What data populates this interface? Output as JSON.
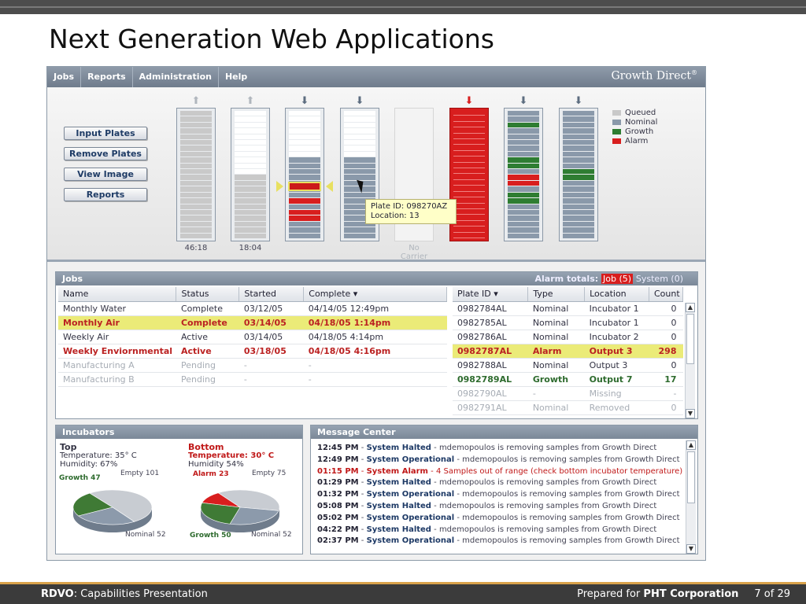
{
  "slide": {
    "title": "Next Generation Web Applications",
    "footer_left_bold": "RDVO",
    "footer_left_rest": ": Capabilities Presentation",
    "footer_prepared": "Prepared for ",
    "footer_client": "PHT Corporation",
    "footer_page": "7 of 29"
  },
  "app": {
    "menu": [
      "Jobs",
      "Reports",
      "Administration",
      "Help"
    ],
    "brand": "Growth Direct",
    "brand_mark": "®"
  },
  "actions": {
    "input_plates": "Input Plates",
    "remove_plates": "Remove Plates",
    "view_image": "View Image",
    "reports": "Reports"
  },
  "carriers": [
    {
      "arrow": "up",
      "label": "46:18",
      "pattern": "qqqqqqqqqqqqqqqqqqqqqq"
    },
    {
      "arrow": "up",
      "label": "18:04",
      "pattern": "eeeeeeeeeeeqqqqqqqqqqq"
    },
    {
      "arrow": "down",
      "label": "",
      "pattern": "eeeeeeeennnnnnnanaannn"
    },
    {
      "arrow": "down",
      "label": "",
      "pattern": "eeeeeeeennnnnnnnnnnnnn"
    },
    {
      "arrow": "none",
      "label": "No Carrier",
      "pattern": "empty"
    },
    {
      "arrow": "down-red",
      "label": "",
      "pattern": "alarm"
    },
    {
      "arrow": "down",
      "label": "",
      "pattern": "nngnnnnnggnaanggnnnnnn"
    },
    {
      "arrow": "down",
      "label": "",
      "pattern": "nnnnnnnnnnggnnnnnnnnnn"
    }
  ],
  "tooltip": {
    "line1": "Plate ID: 098270AZ",
    "line2": "Location: 13"
  },
  "legend": [
    {
      "label": "Queued",
      "color": "#c9c9c9"
    },
    {
      "label": "Nominal",
      "color": "#8a99aa"
    },
    {
      "label": "Growth",
      "color": "#2e7d32"
    },
    {
      "label": "Alarm",
      "color": "#d81e1e"
    }
  ],
  "jobs": {
    "title": "Jobs",
    "alarm_totals_label": "Alarm totals:",
    "alarm_job": "Job (5)",
    "alarm_system": "System (0)",
    "columns": [
      "Name",
      "Status",
      "Started",
      "Complete ▾"
    ],
    "rows": [
      {
        "style": "normal",
        "cells": [
          "Monthly Water",
          "Complete",
          "03/12/05",
          "04/14/05 12:49pm"
        ]
      },
      {
        "style": "hl",
        "cells": [
          "Monthly Air",
          "Complete",
          "03/14/05",
          "04/18/05 1:14pm"
        ]
      },
      {
        "style": "normal",
        "cells": [
          "Weekly Air",
          "Active",
          "03/14/05",
          "04/18/05 4:14pm"
        ]
      },
      {
        "style": "alarm",
        "cells": [
          "Weekly Enviornmental",
          "Active",
          "03/18/05",
          "04/18/05 4:16pm"
        ]
      },
      {
        "style": "pending",
        "cells": [
          "Manufacturing A",
          "Pending",
          "-",
          "-"
        ]
      },
      {
        "style": "pending",
        "cells": [
          "Manufacturing B",
          "Pending",
          "-",
          "-"
        ]
      }
    ]
  },
  "plates": {
    "columns": [
      "Plate ID ▾",
      "Type",
      "Location",
      "Count"
    ],
    "rows": [
      {
        "style": "normal",
        "cells": [
          "0982784AL",
          "Nominal",
          "Incubator 1",
          "0"
        ]
      },
      {
        "style": "normal",
        "cells": [
          "0982785AL",
          "Nominal",
          "Incubator 1",
          "0"
        ]
      },
      {
        "style": "normal",
        "cells": [
          "0982786AL",
          "Nominal",
          "Incubator 2",
          "0"
        ]
      },
      {
        "style": "hl",
        "cells": [
          "0982787AL",
          "Alarm",
          "Output 3",
          "298"
        ]
      },
      {
        "style": "normal",
        "cells": [
          "0982788AL",
          "Nominal",
          "Output 3",
          "0"
        ]
      },
      {
        "style": "growth",
        "cells": [
          "0982789AL",
          "Growth",
          "Output 7",
          "17"
        ]
      },
      {
        "style": "pending",
        "cells": [
          "0982790AL",
          "-",
          "Missing",
          "-"
        ]
      },
      {
        "style": "pending",
        "cells": [
          "0982791AL",
          "Nominal",
          "Removed",
          "0"
        ]
      }
    ]
  },
  "incubators": {
    "title": "Incubators",
    "top": {
      "name": "Top",
      "temp": "Temperature: 35° C",
      "humidity": "Humidity: 67%",
      "slices": [
        {
          "label": "Growth 47",
          "value": 47,
          "color": "#3f7a35"
        },
        {
          "label": "Empty 101",
          "value": 101,
          "color": "#c8ccd2"
        },
        {
          "label": "Nominal 52",
          "value": 52,
          "color": "#8c9aab"
        }
      ]
    },
    "bottom": {
      "name": "Bottom",
      "temp": "Temperature: 30° C",
      "humidity": "Humidity 54%",
      "slices": [
        {
          "label": "Alarm 23",
          "value": 23,
          "color": "#d81e1e"
        },
        {
          "label": "Empty 75",
          "value": 75,
          "color": "#c8ccd2"
        },
        {
          "label": "Nominal 52",
          "value": 52,
          "color": "#8c9aab"
        },
        {
          "label": "Growth 50",
          "value": 50,
          "color": "#3f7a35"
        }
      ]
    }
  },
  "messages": {
    "title": "Message Center",
    "items": [
      {
        "time": "12:45 PM",
        "event": "System Halted",
        "text": "mdemopoulos is removing samples from Growth Direct",
        "alarm": false
      },
      {
        "time": "12:49 PM",
        "event": "System Operational",
        "text": "mdemopoulos is removing samples from Growth Direct",
        "alarm": false
      },
      {
        "time": "01:15 PM",
        "event": "System Alarm",
        "text": "4 Samples out of range (check bottom incubator temperature)",
        "alarm": true
      },
      {
        "time": "01:29 PM",
        "event": "System Halted",
        "text": "mdemopoulos is removing samples from Growth Direct",
        "alarm": false
      },
      {
        "time": "01:32 PM",
        "event": "System Operational",
        "text": "mdemopoulos is removing samples from Growth Direct",
        "alarm": false
      },
      {
        "time": "05:08 PM",
        "event": "System Halted",
        "text": "mdemopoulos is removing samples from Growth Direct",
        "alarm": false
      },
      {
        "time": "05:02 PM",
        "event": "System Operational",
        "text": "mdemopoulos is removing samples from Growth Direct",
        "alarm": false
      },
      {
        "time": "04:22 PM",
        "event": "System Halted",
        "text": "mdemopoulos is removing samples from Growth Direct",
        "alarm": false
      },
      {
        "time": "02:37 PM",
        "event": "System Operational",
        "text": "mdemopoulos is removing samples from Growth Direct",
        "alarm": false
      }
    ]
  }
}
